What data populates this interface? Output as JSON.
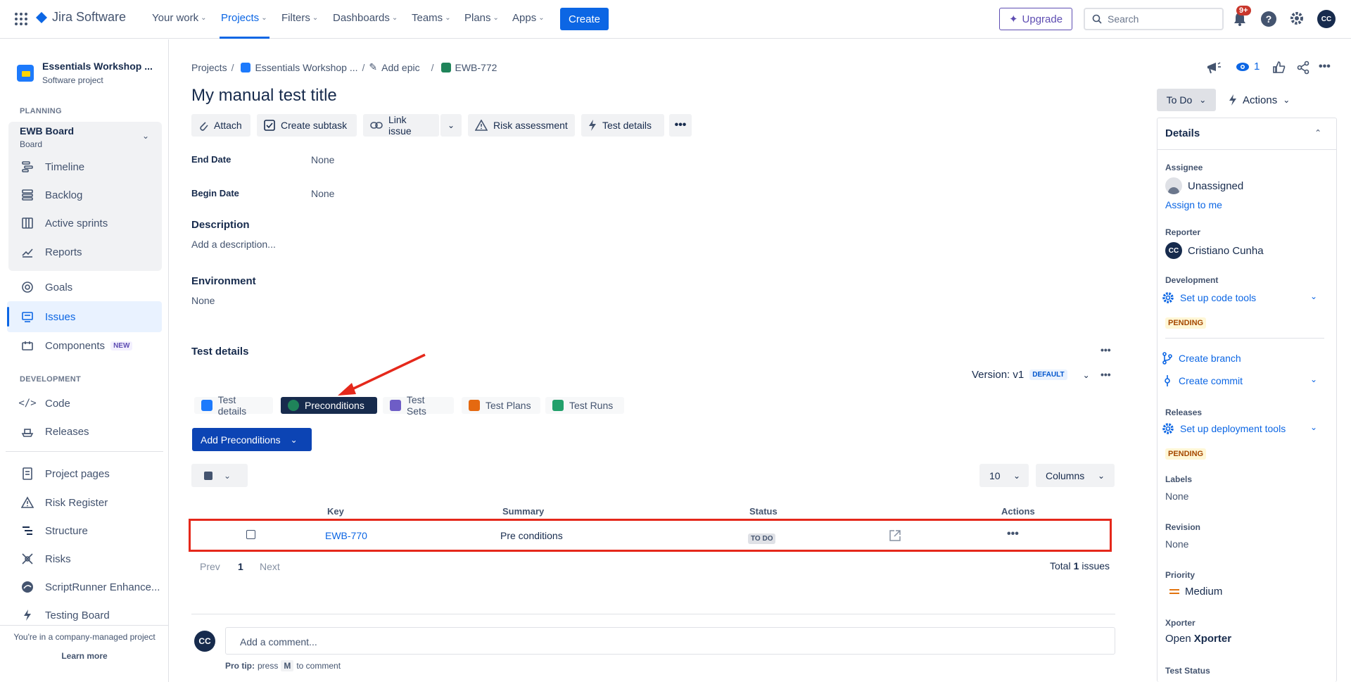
{
  "app": {
    "name": "Jira Software"
  },
  "topnav": {
    "items": [
      {
        "label": "Your work"
      },
      {
        "label": "Projects"
      },
      {
        "label": "Filters"
      },
      {
        "label": "Dashboards"
      },
      {
        "label": "Teams"
      },
      {
        "label": "Plans"
      },
      {
        "label": "Apps"
      }
    ],
    "create_label": "Create",
    "upgrade_label": "Upgrade",
    "search_placeholder": "Search",
    "notifications_badge": "9+",
    "user_initials": "CC"
  },
  "sidebar": {
    "project_name": "Essentials Workshop ...",
    "project_type": "Software project",
    "planning_label": "PLANNING",
    "board_name": "EWB Board",
    "board_sub": "Board",
    "planning_items": [
      {
        "label": "Timeline"
      },
      {
        "label": "Backlog"
      },
      {
        "label": "Active sprints"
      },
      {
        "label": "Reports"
      }
    ],
    "goals_label": "Goals",
    "issues_label": "Issues",
    "components_label": "Components",
    "new_badge": "NEW",
    "development_label": "DEVELOPMENT",
    "dev_items": [
      {
        "label": "Code"
      },
      {
        "label": "Releases"
      }
    ],
    "other_items": [
      {
        "label": "Project pages"
      },
      {
        "label": "Risk Register"
      },
      {
        "label": "Structure"
      },
      {
        "label": "Risks"
      },
      {
        "label": "ScriptRunner Enhance..."
      },
      {
        "label": "Testing Board"
      }
    ],
    "footer_text": "You're in a company-managed project",
    "learn_more": "Learn more"
  },
  "breadcrumb": {
    "projects": "Projects",
    "project": "Essentials Workshop ...",
    "add_epic": "Add epic",
    "issue_key": "EWB-772"
  },
  "issue": {
    "title": "My manual test title",
    "toolbar": {
      "attach": "Attach",
      "create_subtask": "Create subtask",
      "link_issue": "Link issue",
      "risk_assessment": "Risk assessment",
      "test_details": "Test details"
    },
    "fields": {
      "end_date_label": "End Date",
      "end_date_value": "None",
      "begin_date_label": "Begin Date",
      "begin_date_value": "None",
      "description_label": "Description",
      "description_placeholder": "Add a description...",
      "environment_label": "Environment",
      "environment_value": "None"
    }
  },
  "test_details": {
    "title": "Test details",
    "version_label": "Version: v1",
    "default_badge": "DEFAULT",
    "tabs": [
      {
        "label": "Test details",
        "color": "#1d7afc"
      },
      {
        "label": "Preconditions",
        "color": "#1f845a"
      },
      {
        "label": "Test Sets",
        "color": "#6e5dc6"
      },
      {
        "label": "Test Plans",
        "color": "#e56910"
      },
      {
        "label": "Test Runs",
        "color": "#22a06b"
      }
    ],
    "add_button": "Add Preconditions",
    "page_size": "10",
    "columns_label": "Columns",
    "headers": {
      "key": "Key",
      "summary": "Summary",
      "status": "Status",
      "actions": "Actions"
    },
    "rows": [
      {
        "key": "EWB-770",
        "summary": "Pre conditions",
        "status": "TO DO"
      }
    ],
    "pagination": {
      "prev": "Prev",
      "page": "1",
      "next": "Next",
      "total_prefix": "Total",
      "total_count": "1",
      "total_suffix": "issues"
    }
  },
  "comment": {
    "avatar": "CC",
    "placeholder": "Add a comment...",
    "tip_prefix": "Pro tip:",
    "tip_press": "press",
    "tip_key": "M",
    "tip_suffix": "to comment"
  },
  "right_panel": {
    "watchers": "1",
    "status_button": "To Do",
    "actions_button": "Actions",
    "details_title": "Details",
    "assignee_label": "Assignee",
    "assignee_value": "Unassigned",
    "assign_to_me": "Assign to me",
    "reporter_label": "Reporter",
    "reporter_value": "Cristiano Cunha",
    "reporter_initials": "CC",
    "development_label": "Development",
    "setup_code_tools": "Set up code tools",
    "pending": "PENDING",
    "create_branch": "Create branch",
    "create_commit": "Create commit",
    "releases_label": "Releases",
    "setup_deploy_tools": "Set up deployment tools",
    "labels_label": "Labels",
    "labels_value": "None",
    "revision_label": "Revision",
    "revision_value": "None",
    "priority_label": "Priority",
    "priority_value": "Medium",
    "xporter_label": "Xporter",
    "xporter_open": "Open",
    "xporter_name": "Xporter",
    "test_status_label": "Test Status"
  },
  "colors": {
    "accent": "#0c66e4",
    "highlight": "#e5281b",
    "badge": "#c9372c"
  }
}
